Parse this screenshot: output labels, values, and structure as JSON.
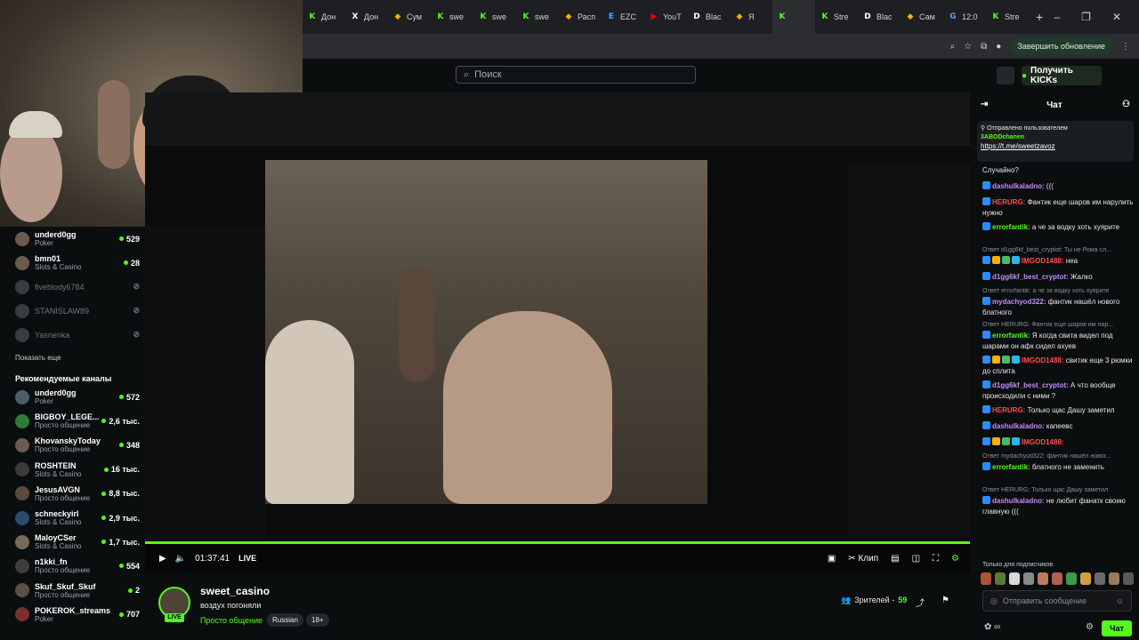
{
  "browser": {
    "tabs": [
      {
        "label": "Дон",
        "icon": "k"
      },
      {
        "label": "Дон",
        "icon": "x"
      },
      {
        "label": "Сум",
        "icon": "o"
      },
      {
        "label": "swe",
        "icon": "k"
      },
      {
        "label": "swe",
        "icon": "k"
      },
      {
        "label": "swe",
        "icon": "k"
      },
      {
        "label": "Расп",
        "icon": "o"
      },
      {
        "label": "EZC",
        "icon": "e"
      },
      {
        "label": "YouT",
        "icon": "y"
      },
      {
        "label": "Blac",
        "icon": "d"
      },
      {
        "label": "Я",
        "icon": "o"
      },
      {
        "label": "",
        "icon": "k",
        "active": true
      },
      {
        "label": "Stre",
        "icon": "k"
      },
      {
        "label": "Blac",
        "icon": "d"
      },
      {
        "label": "Сам",
        "icon": "o"
      },
      {
        "label": "12:0",
        "icon": "g"
      },
      {
        "label": "Stre",
        "icon": "k"
      }
    ],
    "update_label": "Завершить обновление"
  },
  "header": {
    "search_placeholder": "Поиск",
    "get_kicks_label": "Получить KICKs"
  },
  "sidebar": {
    "following": [
      {
        "name": "underd0gg",
        "category": "Poker",
        "viewers": "529",
        "live": true
      },
      {
        "name": "bmn01",
        "category": "Slots & Casino",
        "viewers": "28",
        "live": true
      },
      {
        "name": "fiveblody6784",
        "category": "",
        "viewers": "",
        "live": false
      },
      {
        "name": "STANISLAW89",
        "category": "",
        "viewers": "",
        "live": false
      },
      {
        "name": "Yasnenka",
        "category": "",
        "viewers": "",
        "live": false
      }
    ],
    "show_more": "Показать еще",
    "recommended_title": "Рекомендуемые каналы",
    "recommended": [
      {
        "name": "underd0gg",
        "category": "Poker",
        "viewers": "572"
      },
      {
        "name": "BIGBOY_LEGE...",
        "category": "Просто общение",
        "viewers": "2,6 тыс."
      },
      {
        "name": "KhovanskyToday",
        "category": "Просто общение",
        "viewers": "348"
      },
      {
        "name": "ROSHTEIN",
        "category": "Slots & Casino",
        "viewers": "16 тыс."
      },
      {
        "name": "JesusAVGN",
        "category": "Просто общение",
        "viewers": "8,8 тыс."
      },
      {
        "name": "schneckyirl",
        "category": "Slots & Casino",
        "viewers": "2,9 тыс."
      },
      {
        "name": "MaloyCSer",
        "category": "Slots & Casino",
        "viewers": "1,7 тыс."
      },
      {
        "name": "n1kki_fn",
        "category": "Просто общение",
        "viewers": "554"
      },
      {
        "name": "Skuf_Skuf_Skuf",
        "category": "Просто общение",
        "viewers": "2"
      },
      {
        "name": "POKEROK_streams",
        "category": "Poker",
        "viewers": "707"
      }
    ]
  },
  "player": {
    "time": "01:37:41",
    "live_label": "LIVE",
    "clip_label": "Клип"
  },
  "stream": {
    "channel": "sweet_casino",
    "title": "воздух погоняли",
    "category": "Просто общение",
    "tags": [
      "Russian",
      "18+"
    ],
    "viewers_label": "Зрителей -",
    "viewers_count": "59"
  },
  "chat": {
    "title": "Чат",
    "pinned_label": "Отправлено пользователем",
    "pinned_user": "3ABODchanen",
    "pinned_link": "https://t.me/sweetzavoz",
    "messages": [
      {
        "user": "",
        "text": "Случайно?",
        "color": "#e8e8e8"
      },
      {
        "user": "dashulkaladno:",
        "text": "(((",
        "color": "#c48cf5"
      },
      {
        "user": "HERURG:",
        "text": "Фантик еще шаров им нарулить нужно",
        "color": "#ff4d4d"
      },
      {
        "user": "errorfantik:",
        "text": "а че за водку хоть хуярите",
        "color": "#53fc18"
      },
      {
        "reply": "Ответ d1gg6kf_best_cryptot: Ты не Рома сл..."
      },
      {
        "user": "IMGOD1488:",
        "text": "нea",
        "color": "#ff4d4d"
      },
      {
        "user": "d1gg6kf_best_cryptot:",
        "text": "Жалко",
        "color": "#c48cf5"
      },
      {
        "reply": "Ответ errorfantik: а че за водку хоть хуярите"
      },
      {
        "user": "mydachyod322:",
        "text": "фантик нашёл нового блатного",
        "color": "#c48cf5"
      },
      {
        "reply": "Ответ HERURG: Фантик еще шаров им нар..."
      },
      {
        "user": "errorfantik:",
        "text": "Я когда свита видел под шарами он афк сидел ахуев",
        "color": "#53fc18"
      },
      {
        "user": "IMGOD1488:",
        "text": "свитик еще 3 рюмки до сплита",
        "color": "#ff4d4d"
      },
      {
        "user": "d1gg6kf_best_cryptot:",
        "text": "А что вообще происходили с ними ?",
        "color": "#c48cf5"
      },
      {
        "user": "HERURG:",
        "text": "Только щас Дашу заметил",
        "color": "#ff4d4d"
      },
      {
        "user": "dashulkaladno:",
        "text": "капеевс",
        "color": "#c48cf5"
      },
      {
        "user": "IMGOD1488:",
        "text": "",
        "color": "#ff4d4d"
      },
      {
        "reply": "Ответ mydachyod322: фантик нашёл новог..."
      },
      {
        "user": "errorfantik:",
        "text": "блатного не заменить",
        "color": "#53fc18"
      },
      {
        "reply": "Ответ HERURG: Только щас Дашу заметил"
      },
      {
        "user": "dashulkaladno:",
        "text": "не любит фанатк своию главную (((",
        "color": "#c48cf5"
      }
    ],
    "sub_only_label": "Только для подписчиков",
    "input_placeholder": "Отправить сообщение",
    "send_label": "Чат"
  },
  "colors": {
    "accent": "#53fc18",
    "bg": "#0b0e0f"
  }
}
